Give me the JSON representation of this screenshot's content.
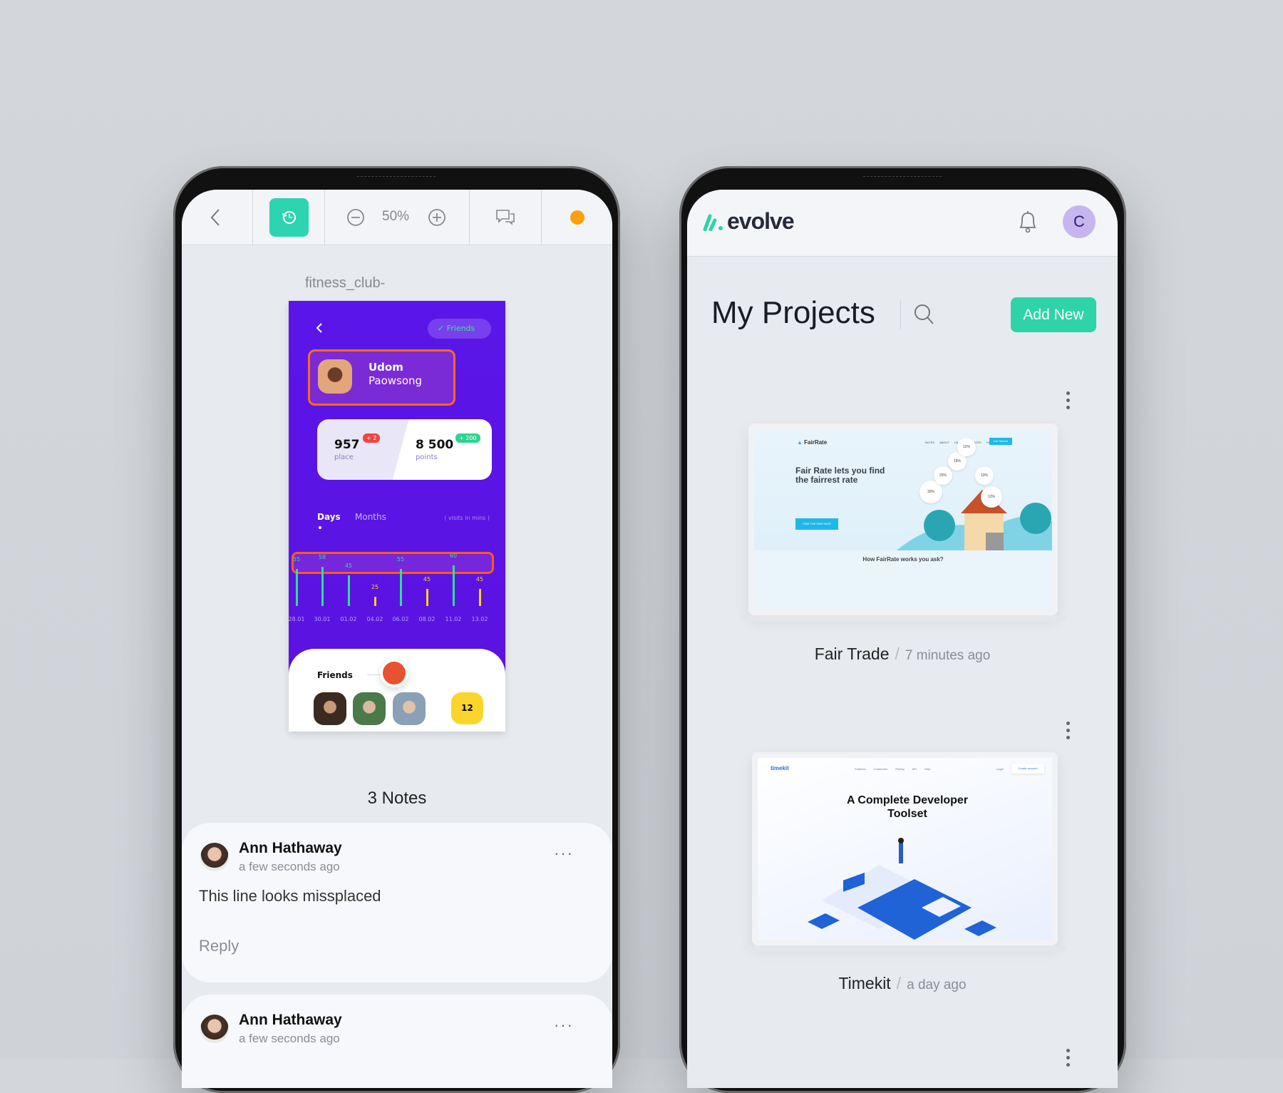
{
  "left_phone": {
    "toolbar": {
      "zoom_level": "50%",
      "status_color": "#ff9f0a",
      "accent": "#2dd4b0"
    },
    "artboard_title": "fitness_club-",
    "artboard": {
      "friends_pill": "Friends",
      "profile": {
        "first_name": "Udom",
        "last_name": "Paowsong"
      },
      "stats": [
        {
          "value": "957",
          "label": "place",
          "badge": "+ 2"
        },
        {
          "value": "8 500",
          "label": "points",
          "badge": "+ 200"
        }
      ],
      "tabs": [
        "Days",
        "Months"
      ],
      "units_note": "( visits in mins )",
      "friends_label": "Friends",
      "friends_more": "12"
    },
    "chart_data": {
      "type": "bar",
      "title": "visits in mins",
      "categories": [
        "28.01",
        "30.01",
        "01.02",
        "04.02",
        "06.02",
        "08.02",
        "11.02",
        "13.02"
      ],
      "values": [
        55,
        58,
        45,
        25,
        55,
        45,
        60,
        45
      ],
      "highlight": [
        "green",
        "green",
        "green",
        "yellow",
        "green",
        "yellow",
        "green",
        "yellow"
      ]
    },
    "notes_title": "3 Notes",
    "notes": [
      {
        "author": "Ann Hathaway",
        "time": "a few seconds ago",
        "text": "This line looks missplaced",
        "reply": "Reply"
      },
      {
        "author": "Ann Hathaway",
        "time": "a few seconds ago"
      }
    ]
  },
  "right_phone": {
    "logo": "evolve",
    "avatar_initial": "C",
    "page_title": "My Projects",
    "add_button": "Add New",
    "projects": [
      {
        "name": "Fair Trade",
        "time": "7 minutes ago",
        "preview": {
          "brand": "FairRate",
          "nav": [
            "RATES",
            "ABOUT US",
            "RESOURCES",
            "FAQ"
          ],
          "cta": "Get Started",
          "headline": "Fair Rate lets you find the fairrest rate",
          "button": "FIND THE FAIR RATE",
          "section": "How FairRate works you ask?",
          "bubbles": [
            "30%",
            "18%",
            "12%",
            "10%",
            "12%",
            "25%"
          ]
        }
      },
      {
        "name": "Timekit",
        "time": "a day ago",
        "preview": {
          "brand": "timekit",
          "nav": [
            "Features",
            "Customers",
            "Pricing",
            "API",
            "Help"
          ],
          "login": "Login",
          "cta": "Create account",
          "headline": "A Complete Developer Toolset"
        }
      }
    ]
  }
}
